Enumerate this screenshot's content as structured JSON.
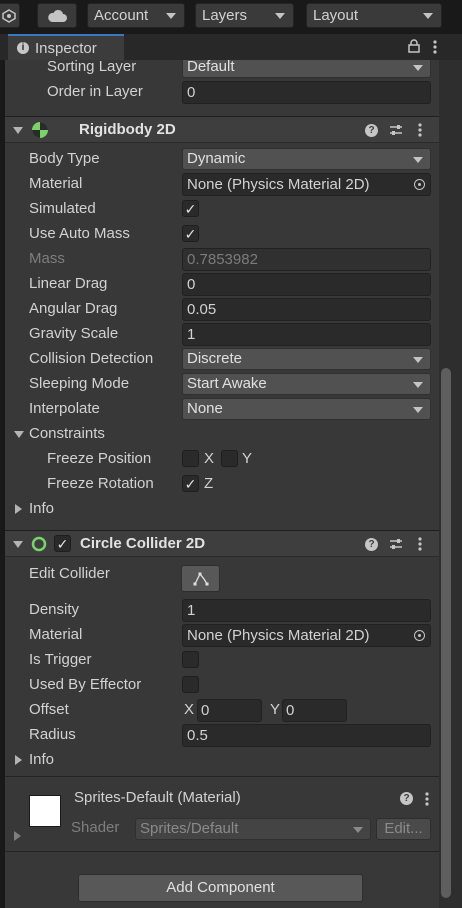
{
  "toolbar": {
    "account_label": "Account",
    "layers_label": "Layers",
    "layout_label": "Layout"
  },
  "tab": {
    "title": "Inspector"
  },
  "renderer": {
    "sorting_layer": {
      "label": "Sorting Layer",
      "value": "Default"
    },
    "order_in_layer": {
      "label": "Order in Layer",
      "value": "0"
    }
  },
  "rigidbody": {
    "title": "Rigidbody 2D",
    "body_type": {
      "label": "Body Type",
      "value": "Dynamic"
    },
    "material": {
      "label": "Material",
      "value": "None (Physics Material 2D)"
    },
    "simulated": {
      "label": "Simulated",
      "checked": "✓"
    },
    "use_auto_mass": {
      "label": "Use Auto Mass",
      "checked": "✓"
    },
    "mass": {
      "label": "Mass",
      "value": "0.7853982"
    },
    "linear_drag": {
      "label": "Linear Drag",
      "value": "0"
    },
    "angular_drag": {
      "label": "Angular Drag",
      "value": "0.05"
    },
    "gravity_scale": {
      "label": "Gravity Scale",
      "value": "1"
    },
    "collision_detection": {
      "label": "Collision Detection",
      "value": "Discrete"
    },
    "sleeping_mode": {
      "label": "Sleeping Mode",
      "value": "Start Awake"
    },
    "interpolate": {
      "label": "Interpolate",
      "value": "None"
    },
    "constraints": {
      "label": "Constraints",
      "freeze_position": {
        "label": "Freeze Position",
        "x": "X",
        "y": "Y"
      },
      "freeze_rotation": {
        "label": "Freeze Rotation",
        "z": "Z",
        "checked": "✓"
      }
    },
    "info": "Info"
  },
  "circle_collider": {
    "title": "Circle Collider 2D",
    "enabled_check": "✓",
    "edit_collider": {
      "label": "Edit Collider"
    },
    "density": {
      "label": "Density",
      "value": "1"
    },
    "material": {
      "label": "Material",
      "value": "None (Physics Material 2D)"
    },
    "is_trigger": {
      "label": "Is Trigger"
    },
    "used_by_effector": {
      "label": "Used By Effector"
    },
    "offset": {
      "label": "Offset",
      "x_label": "X",
      "x": "0",
      "y_label": "Y",
      "y": "0"
    },
    "radius": {
      "label": "Radius",
      "value": "0.5"
    },
    "info": "Info"
  },
  "material_block": {
    "title": "Sprites-Default (Material)",
    "shader_label": "Shader",
    "shader_value": "Sprites/Default",
    "edit_label": "Edit..."
  },
  "add_component_label": "Add Component",
  "colors": {
    "accent_tab": "#3a79bb",
    "rigidbody_icon": "#7ad36a",
    "panel_bg": "#383838"
  }
}
